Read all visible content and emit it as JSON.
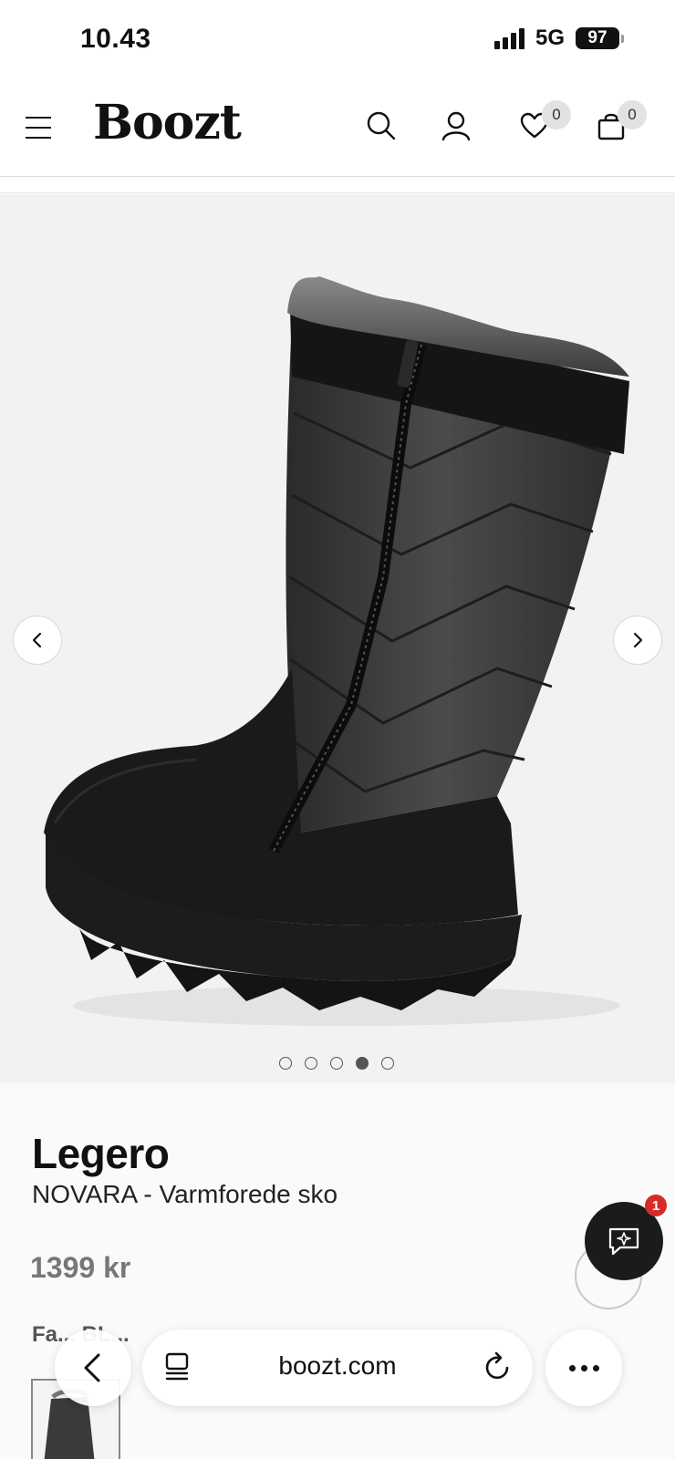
{
  "status_bar": {
    "time": "10.43",
    "network": "5G",
    "battery": "97"
  },
  "header": {
    "logo": "Boozt",
    "wishlist_count": "0",
    "cart_count": "0"
  },
  "gallery": {
    "image": "black-quilted-winter-boot-with-fur-collar",
    "total_slides": 5,
    "active_slide": 4
  },
  "product": {
    "brand": "Legero",
    "name": "NOVARA - Varmforede sko",
    "price": "1399 kr",
    "color_label": "Fa... BL..."
  },
  "chat": {
    "badge": "1"
  },
  "browser": {
    "url": "boozt.com"
  },
  "colors": {
    "accent": "#1b1b1b",
    "badge": "#d62b2b",
    "gallery_bg": "#f2f2f2"
  }
}
